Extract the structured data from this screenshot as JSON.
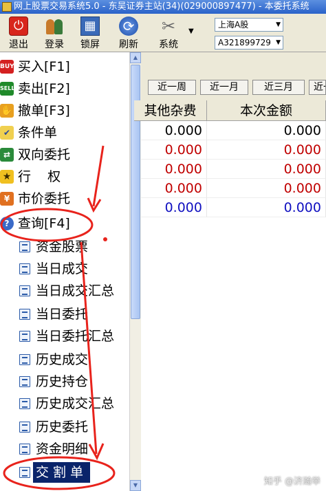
{
  "window": {
    "title": "网上股票交易系统5.0 - 东吴证券主站(34)(029000897477) - 本委托系统"
  },
  "toolbar": {
    "exit_label": "退出",
    "login_label": "登录",
    "lock_label": "锁屏",
    "refresh_label": "刷新",
    "system_label": "系统",
    "market_select": "上海A股",
    "account_select": "A321899729"
  },
  "sidebar": {
    "buy": {
      "label": "买入[F1]",
      "icon_text": "BUY"
    },
    "sell": {
      "label": "卖出[F2]",
      "icon_text": "SELL"
    },
    "cancel": {
      "label": "撤单[F3]"
    },
    "conditional": {
      "label": "条件单"
    },
    "bidirectional": {
      "label": "双向委托"
    },
    "exercise": {
      "label": "行    权"
    },
    "market_order": {
      "label": "市价委托"
    },
    "query": {
      "label": "查询[F4]"
    },
    "query_items": [
      "资金股票",
      "当日成交",
      "当日成交汇总",
      "当日委托",
      "当日委托汇总",
      "历史成交",
      "历史持仓",
      "历史成交汇总",
      "历史委托",
      "资金明细",
      "交割单"
    ]
  },
  "period_buttons": [
    "近一周",
    "近一月",
    "近三月",
    "近一"
  ],
  "table": {
    "columns": [
      "其他杂费",
      "本次金额"
    ],
    "rows": [
      {
        "fee": "0.000",
        "amount": "0.000",
        "color": "black"
      },
      {
        "fee": "0.000",
        "amount": "0.000",
        "color": "red"
      },
      {
        "fee": "0.000",
        "amount": "0.000",
        "color": "red"
      },
      {
        "fee": "0.000",
        "amount": "0.000",
        "color": "red"
      },
      {
        "fee": "0.000",
        "amount": "0.000",
        "color": "blue"
      }
    ]
  },
  "watermark": "知乎 @济瀚举",
  "colors": {
    "annotation_red": "#e8231c",
    "selection_bg": "#0a246a",
    "positive_red": "#c00000",
    "negative_blue": "#1010c0"
  }
}
